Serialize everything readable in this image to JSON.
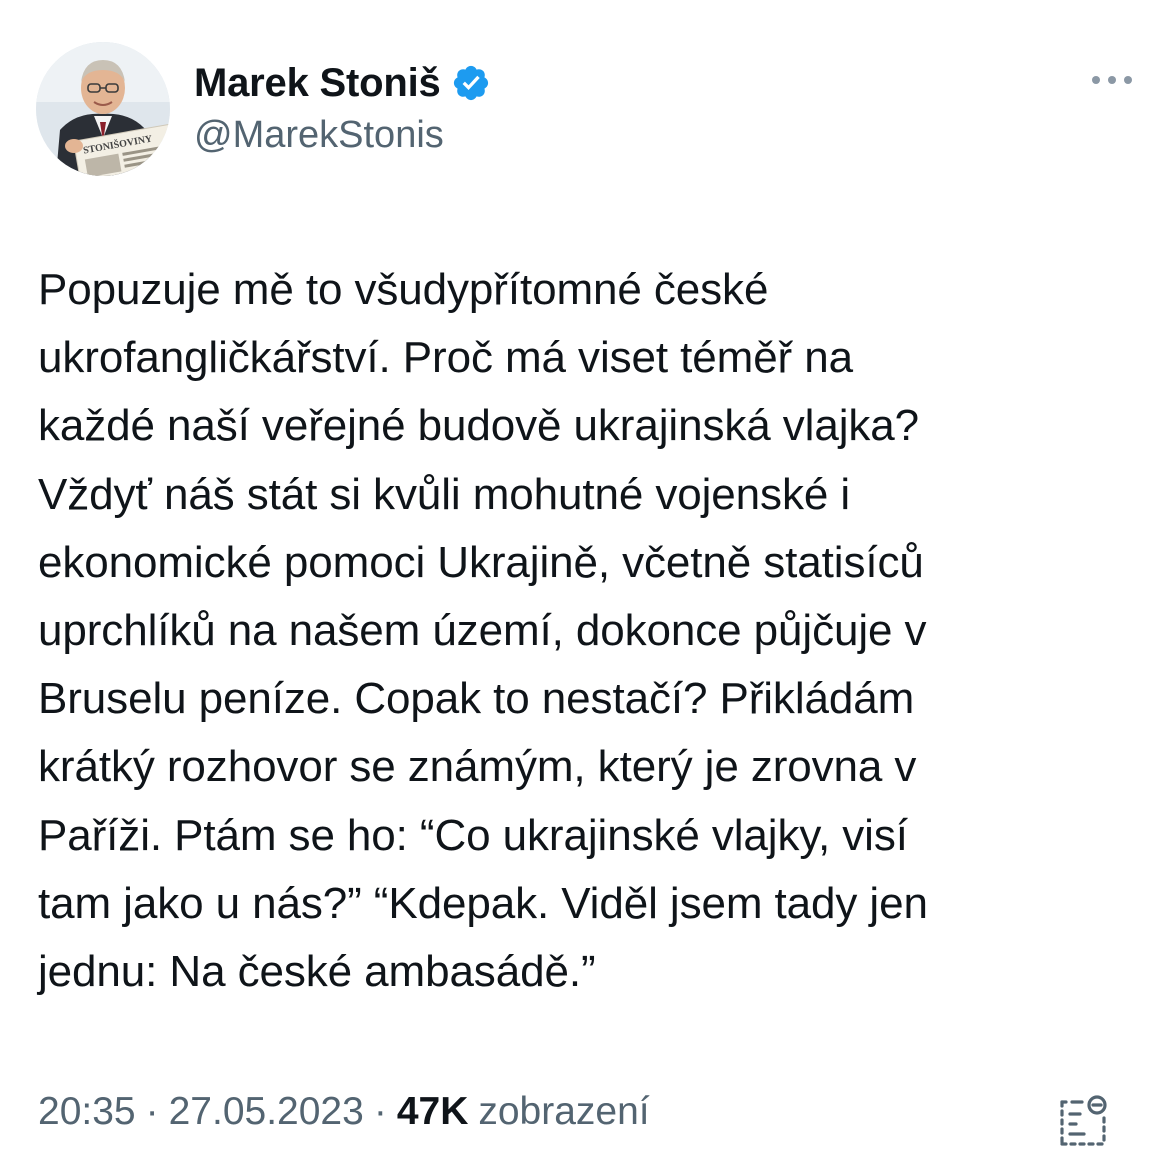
{
  "author": {
    "display_name": "Marek Stoniš",
    "handle": "@MarekStonis",
    "avatar_caption": "STONIŠOVINY",
    "verified": true,
    "verified_color": "#1d9bf0"
  },
  "tweet": {
    "text": "Popuzuje mě to všudypřítomné české\nukrofangličkářství. Proč má viset téměř na\nkaždé naší veřejné budově ukrajinská vlajka?\nVždyť náš stát si kvůli mohutné vojenské i\nekonomické pomoci Ukrajině, včetně statisíců\nuprchlíků na našem území, dokonce půjčuje v\nBruselu peníze. Copak to nestačí? Přikládám\nkrátký rozhovor se známým, který je zrovna v\nPaříži. Ptám se ho: “Co ukrajinské vlajky, visí\ntam jako u nás?” “Kdepak. Viděl jsem tady jen\njednu: Na české ambasádě.”"
  },
  "meta": {
    "time": "20:35",
    "separator": "·",
    "date": "27.05.2023",
    "views_count": "47K",
    "views_label": "zobrazení"
  },
  "icons": {
    "more": "more-horizontal-icon",
    "verified": "verified-badge-icon",
    "analytics": "analytics-icon"
  },
  "colors": {
    "text_primary": "#0f1419",
    "text_secondary": "#536471",
    "accent": "#1d9bf0"
  }
}
